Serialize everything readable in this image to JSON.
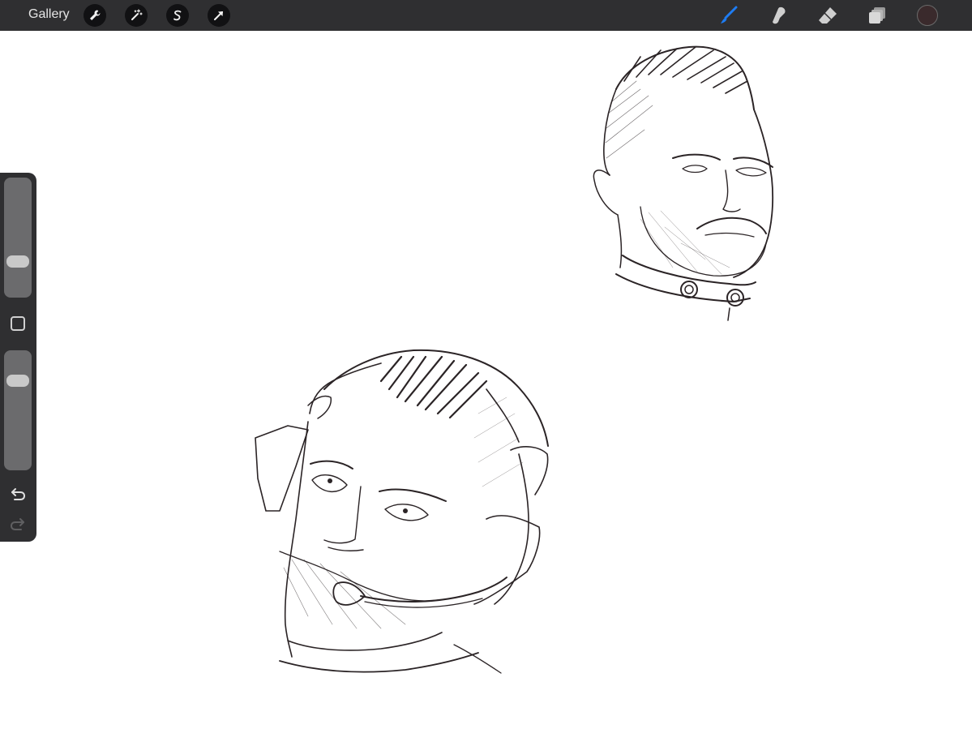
{
  "topbar": {
    "gallery_label": "Gallery",
    "left_tools": [
      "wrench-icon",
      "magic-wand-icon",
      "selection-icon",
      "transform-arrow-icon"
    ],
    "right_tools": [
      "brush-icon",
      "smudge-icon",
      "eraser-icon",
      "layers-icon"
    ],
    "active_tool": "brush-icon",
    "accent_color": "#1e7cf2",
    "current_color": "#3a2a2c"
  },
  "sidebar": {
    "brush_size_level": 0.27,
    "opacity_level": 0.21,
    "icons": [
      "modify-square-icon",
      "undo-icon",
      "redo-icon"
    ]
  },
  "canvas": {
    "background": "#ffffff",
    "stroke_color": "#2b2426"
  }
}
